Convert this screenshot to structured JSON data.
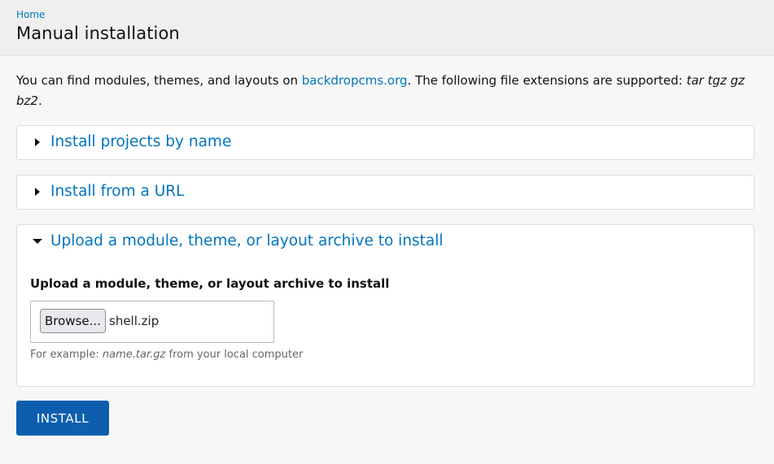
{
  "breadcrumb": {
    "home_label": "Home"
  },
  "page": {
    "title": "Manual installation"
  },
  "intro": {
    "prefix": "You can find modules, themes, and layouts on ",
    "link_text": "backdropcms.org",
    "suffix": ". The following file extensions are supported: ",
    "extensions": "tar tgz gz bz2",
    "end": "."
  },
  "sections": {
    "by_name": {
      "label": "Install projects by name",
      "expanded": false
    },
    "from_url": {
      "label": "Install from a URL",
      "expanded": false
    },
    "upload": {
      "label": "Upload a module, theme, or layout archive to install",
      "expanded": true,
      "field_label": "Upload a module, theme, or layout archive to install",
      "browse_label": "Browse...",
      "file_name": "shell.zip",
      "description_prefix": "For example: ",
      "description_example": "name.tar.gz",
      "description_suffix": " from your local computer"
    }
  },
  "actions": {
    "install_label": "INSTALL"
  },
  "colors": {
    "link": "#0074bd",
    "primary_button": "#0d5fae",
    "header_bg": "#efefef",
    "page_bg": "#f7f7f7"
  },
  "icons": {
    "collapsed": "triangle-right-icon",
    "expanded": "triangle-down-icon"
  }
}
